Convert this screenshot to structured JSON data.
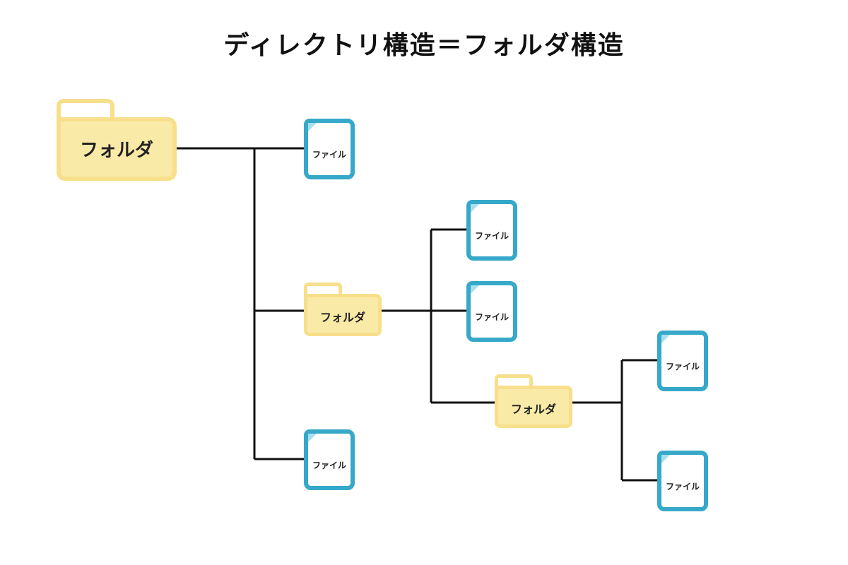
{
  "title": "ディレクトリ構造＝フォルダ構造",
  "labels": {
    "folder": "フォルダ",
    "file": "ファイル"
  },
  "tree": {
    "type": "folder",
    "children": [
      {
        "type": "file"
      },
      {
        "type": "folder",
        "children": [
          {
            "type": "file"
          },
          {
            "type": "file"
          },
          {
            "type": "folder",
            "children": [
              {
                "type": "file"
              },
              {
                "type": "file"
              }
            ]
          }
        ]
      },
      {
        "type": "file"
      }
    ]
  },
  "colors": {
    "folder": "#faeaa7",
    "folderStroke": "#f7df8b",
    "fileStroke": "#36a8c9",
    "line": "#111"
  }
}
